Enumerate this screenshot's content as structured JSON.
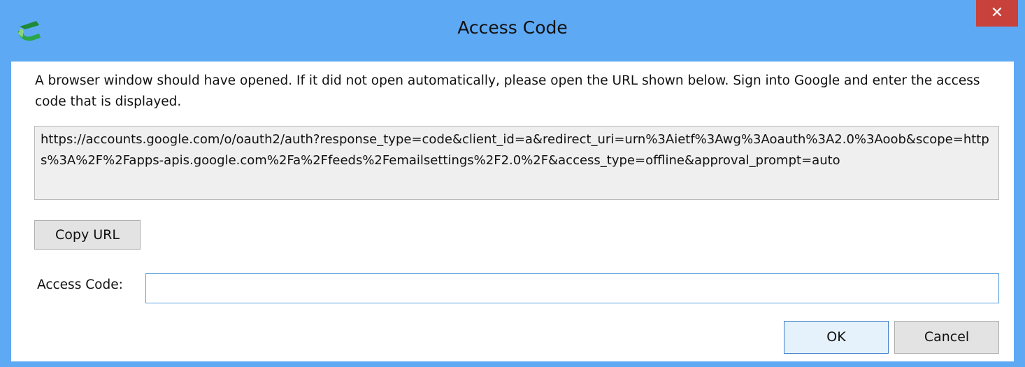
{
  "window": {
    "title": "Access Code",
    "close_glyph": "✕",
    "app_icon": "app-logo-icon"
  },
  "dialog": {
    "message": "A browser window should have opened. If it did not open automatically, please open the URL shown below. Sign into Google and enter the access code that is displayed.",
    "url": "https://accounts.google.com/o/oauth2/auth?response_type=code&client_id=a&redirect_uri=urn%3Aietf%3Awg%3Aoauth%3A2.0%3Aoob&scope=https%3A%2F%2Fapps-apis.google.com%2Fa%2Ffeeds%2Femailsettings%2F2.0%2F&access_type=offline&approval_prompt=auto",
    "copy_url_label": "Copy URL",
    "access_code_label": "Access Code:",
    "access_code_value": "",
    "ok_label": "OK",
    "cancel_label": "Cancel"
  },
  "colors": {
    "titlebar": "#5ea9f4",
    "close_button": "#c8413b",
    "url_box_bg": "#efefef",
    "focus_border": "#5aa0dd"
  }
}
